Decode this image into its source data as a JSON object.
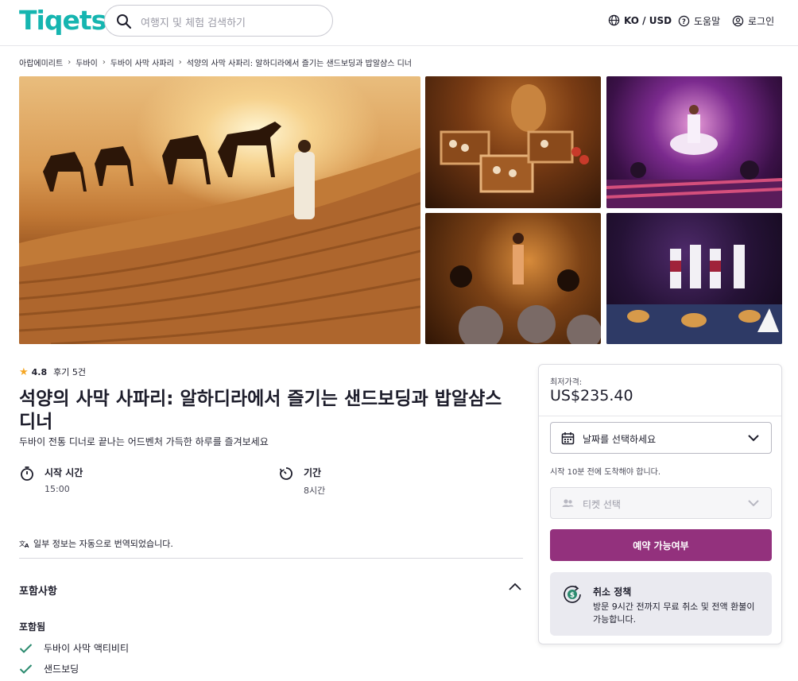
{
  "header": {
    "logo": "Tiqets",
    "search_placeholder": "여행지 및 체험 검색하기",
    "lang_currency": "KO / USD",
    "help": "도움말",
    "login": "로그인"
  },
  "breadcrumb": [
    "아랍에미리트",
    "두바이",
    "두바이 사막 사파리",
    "석양의 사막 사파리: 알하디라에서 즐기는 샌드보딩과 밥알샴스 디너"
  ],
  "gallery": {
    "images": [
      "desert-camel-caravan",
      "buffet-dessert-table",
      "tanoura-dancer-show",
      "belly-dance-dinner",
      "folk-dance-stage-dinner"
    ]
  },
  "product": {
    "rating": "4.8",
    "reviews": "후기 5건",
    "title": "석양의 사막 사파리: 알하디라에서 즐기는 샌드보딩과 밥알샴스 디너",
    "subtitle": "두바이 전통 디너로 끝나는 어드벤처 가득한 하루를 즐겨보세요",
    "start_label": "시작 시간",
    "start_value": "15:00",
    "duration_label": "기간",
    "duration_value": "8시간",
    "translated_note": "일부 정보는 자동으로 번역되었습니다."
  },
  "inclusions": {
    "heading": "포함사항",
    "sub": "포함됨",
    "items": [
      "두바이 사막 액티비티",
      "샌드보딩"
    ]
  },
  "booking": {
    "from_label": "최저가격:",
    "price": "US$235.40",
    "date_placeholder": "날짜를 선택하세요",
    "arrival_note": "시작 10분 전에 도착해야 합니다.",
    "ticket_placeholder": "티켓 선택",
    "button": "예약 가능여부",
    "policy_title": "취소 정책",
    "policy_text": "방문 9시간 전까지 무료 취소 및 전액 환불이 가능합니다."
  },
  "colors": {
    "brand": "#16b5b0",
    "primary_button": "#93317d",
    "star": "#f5a623",
    "check": "#2a8a6e"
  }
}
